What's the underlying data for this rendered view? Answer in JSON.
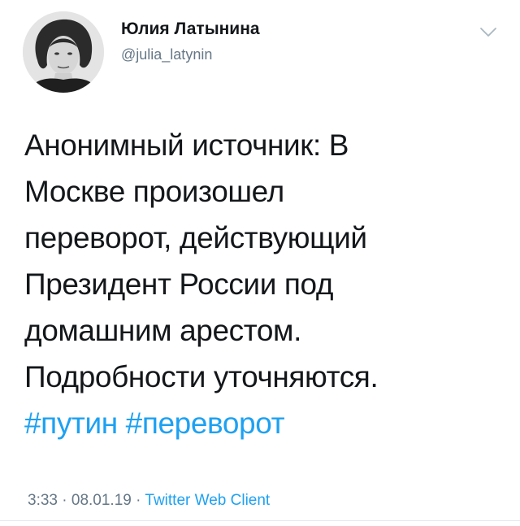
{
  "author": {
    "name": "Юлия Латынина",
    "handle": "@julia_latynin"
  },
  "tweet": {
    "lines": [
      "Анонимный источник: В",
      "Москве произошел",
      "переворот, действующий",
      "Президент России под",
      "домашним арестом.",
      "Подробности уточняются."
    ],
    "hashtags": [
      "#путин",
      "#переворот"
    ]
  },
  "meta": {
    "time": "3:33",
    "separator1": " · ",
    "date": "08.01.19",
    "separator2": " · ",
    "source": "Twitter Web Client"
  },
  "icons": {
    "menu": "chevron-down-icon",
    "avatar": "avatar"
  },
  "colors": {
    "text": "#14171a",
    "secondary": "#657786",
    "link": "#1da1f2"
  }
}
